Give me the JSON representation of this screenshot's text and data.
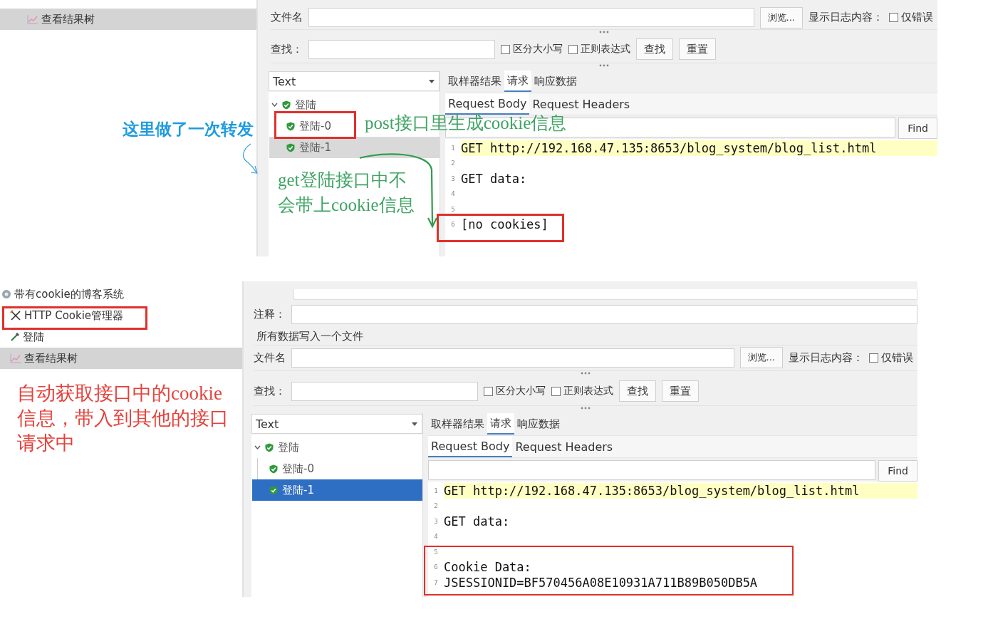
{
  "screenshots": [
    {
      "test_plan": [
        {
          "label": "查看结果树",
          "kind": "listener",
          "selected": true
        }
      ],
      "file_label": "文件名",
      "browse_button": "浏览...",
      "log_label": "显示日志内容：",
      "errors_only": {
        "label": "仅错误",
        "checked": false
      },
      "search_label": "查找：",
      "search_options": [
        {
          "label": "区分大小写",
          "checked": false
        },
        {
          "label": "正则表达式",
          "checked": false
        }
      ],
      "search_buttons": [
        "查找",
        "重置"
      ],
      "renderer": "Text",
      "results": [
        {
          "label": "登陆",
          "expanded": true,
          "children": [
            {
              "label": "登陆-0",
              "selected": false
            },
            {
              "label": "登陆-1",
              "selected": true
            }
          ]
        }
      ],
      "selection_focused": false,
      "tabs": [
        {
          "label": "取样器结果",
          "selected": false
        },
        {
          "label": "请求",
          "selected": true
        },
        {
          "label": "响应数据",
          "selected": false
        }
      ],
      "body_tabs": [
        {
          "label": "Request Body",
          "selected": true
        },
        {
          "label": "Request Headers",
          "selected": false
        }
      ],
      "find_button": "Find",
      "code_lines": [
        {
          "number": "1",
          "text": "GET http://192.168.47.135:8653/blog_system/blog_list.html",
          "highlighted": true
        },
        {
          "number": "2",
          "highlighted": false
        },
        {
          "number": "3",
          "text": "GET data:",
          "highlighted": false
        },
        {
          "number": "4",
          "highlighted": false
        },
        {
          "number": "5",
          "highlighted": false
        },
        {
          "number": "6",
          "text": "[no cookies]",
          "highlighted": false
        }
      ]
    },
    {
      "test_plan": [
        {
          "label": "带有cookie的博客系统",
          "kind": "plan",
          "selected": false
        },
        {
          "label": "HTTP Cookie管理器",
          "kind": "config",
          "selected": false
        },
        {
          "label": "登陆",
          "kind": "sampler",
          "selected": false
        },
        {
          "label": "查看结果树",
          "kind": "listener",
          "selected": true
        }
      ],
      "comment_label": "注释：",
      "group_label": "所有数据写入一个文件",
      "file_label": "文件名",
      "browse_button": "浏览...",
      "log_label": "显示日志内容：",
      "errors_only": {
        "label": "仅错误",
        "checked": false
      },
      "search_label": "查找：",
      "search_options": [
        {
          "label": "区分大小写",
          "checked": false
        },
        {
          "label": "正则表达式",
          "checked": false
        }
      ],
      "search_buttons": [
        "查找",
        "重置"
      ],
      "renderer": "Text",
      "results": [
        {
          "label": "登陆",
          "expanded": true,
          "children": [
            {
              "label": "登陆-0",
              "selected": false
            },
            {
              "label": "登陆-1",
              "selected": true
            }
          ]
        }
      ],
      "selection_focused": true,
      "tabs": [
        {
          "label": "取样器结果",
          "selected": false
        },
        {
          "label": "请求",
          "selected": true
        },
        {
          "label": "响应数据",
          "selected": false
        }
      ],
      "body_tabs": [
        {
          "label": "Request Body",
          "selected": true
        },
        {
          "label": "Request Headers",
          "selected": false
        }
      ],
      "find_button": "Find",
      "code_lines": [
        {
          "number": "1",
          "text": "GET http://192.168.47.135:8653/blog_system/blog_list.html",
          "highlighted": true
        },
        {
          "number": "2",
          "highlighted": false
        },
        {
          "number": "3",
          "text": "GET data:",
          "highlighted": false
        },
        {
          "number": "4",
          "highlighted": false
        },
        {
          "number": "5",
          "highlighted": false
        },
        {
          "number": "6",
          "text": "Cookie Data:",
          "highlighted": false
        },
        {
          "number": "7",
          "text": "JSESSIONID=BF570456A08E10931A711B89B050DB5A",
          "highlighted": false
        }
      ]
    }
  ],
  "annotations": [
    {
      "kind": "caption",
      "text": "这里做了一次转发",
      "color": "#1e9be0"
    },
    {
      "kind": "note",
      "text": "post接口里生成cookie信息",
      "color": "#3fa463"
    },
    {
      "kind": "note",
      "text": "get登陆接口中不会带上cookie信息",
      "color": "#3fa463"
    },
    {
      "kind": "note",
      "text": "自动获取接口中的cookie信息，带入到其他的接口请求中",
      "color": "#e5413b"
    }
  ]
}
